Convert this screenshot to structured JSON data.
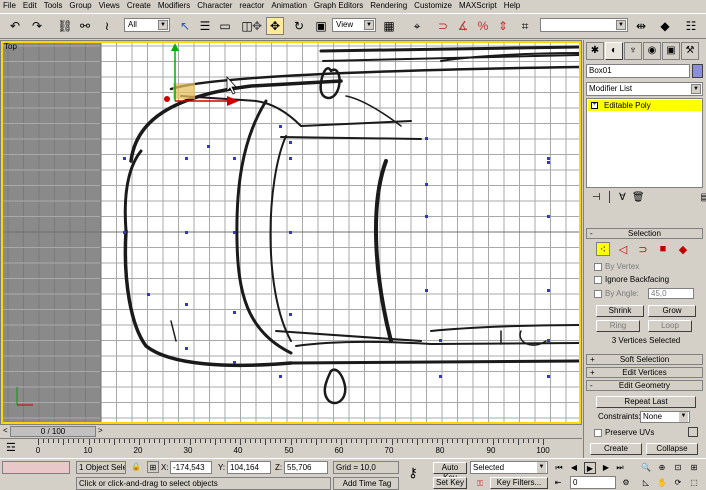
{
  "menu": [
    "File",
    "Edit",
    "Tools",
    "Group",
    "Views",
    "Create",
    "Modifiers",
    "Character",
    "reactor",
    "Animation",
    "Graph Editors",
    "Rendering",
    "Customize",
    "MAXScript",
    "Help"
  ],
  "toolbar": {
    "selection_filter": "All",
    "reference_coord": "View",
    "named_selection": ""
  },
  "viewport": {
    "label": "Top"
  },
  "command_panel": {
    "tabs": [
      "create-icon",
      "modify-icon",
      "hierarchy-icon",
      "motion-icon",
      "display-icon",
      "utilities-icon"
    ],
    "object_name": "Box01",
    "object_color": "#8a8edc",
    "modifier_list": "Modifier List",
    "stack_item": "Editable Poly",
    "selection": {
      "title": "Selection",
      "by_vertex": "By Vertex",
      "ignore_backfacing": "Ignore Backfacing",
      "by_angle": "By Angle:",
      "angle_value": "45,0",
      "shrink": "Shrink",
      "grow": "Grow",
      "ring": "Ring",
      "loop": "Loop",
      "info": "3 Vertices Selected"
    },
    "soft_selection": "Soft Selection",
    "edit_vertices": "Edit Vertices",
    "edit_geometry": "Edit Geometry",
    "repeat_last": "Repeat Last",
    "constraints_label": "Constraints:",
    "constraints_value": "None",
    "preserve_uvs": "Preserve UVs",
    "create": "Create",
    "collapse": "Collapse"
  },
  "timeline": {
    "slider": "0 / 100",
    "ticks": [
      "0",
      "10",
      "20",
      "30",
      "40",
      "50",
      "60",
      "70",
      "80",
      "90",
      "100"
    ]
  },
  "status": {
    "selected_count": "1 Object Sele",
    "x_label": "X:",
    "x_value": "-174,543",
    "y_label": "Y:",
    "y_value": "104,164",
    "z_label": "Z:",
    "z_value": "55,706",
    "grid": "Grid = 10,0",
    "prompt": "Click or click-and-drag to select objects",
    "add_time_tag": "Add Time Tag",
    "auto_key": "Auto Key",
    "set_key": "Set Key",
    "key_mode": "Selected",
    "key_filters": "Key Filters...",
    "frame": "0"
  }
}
